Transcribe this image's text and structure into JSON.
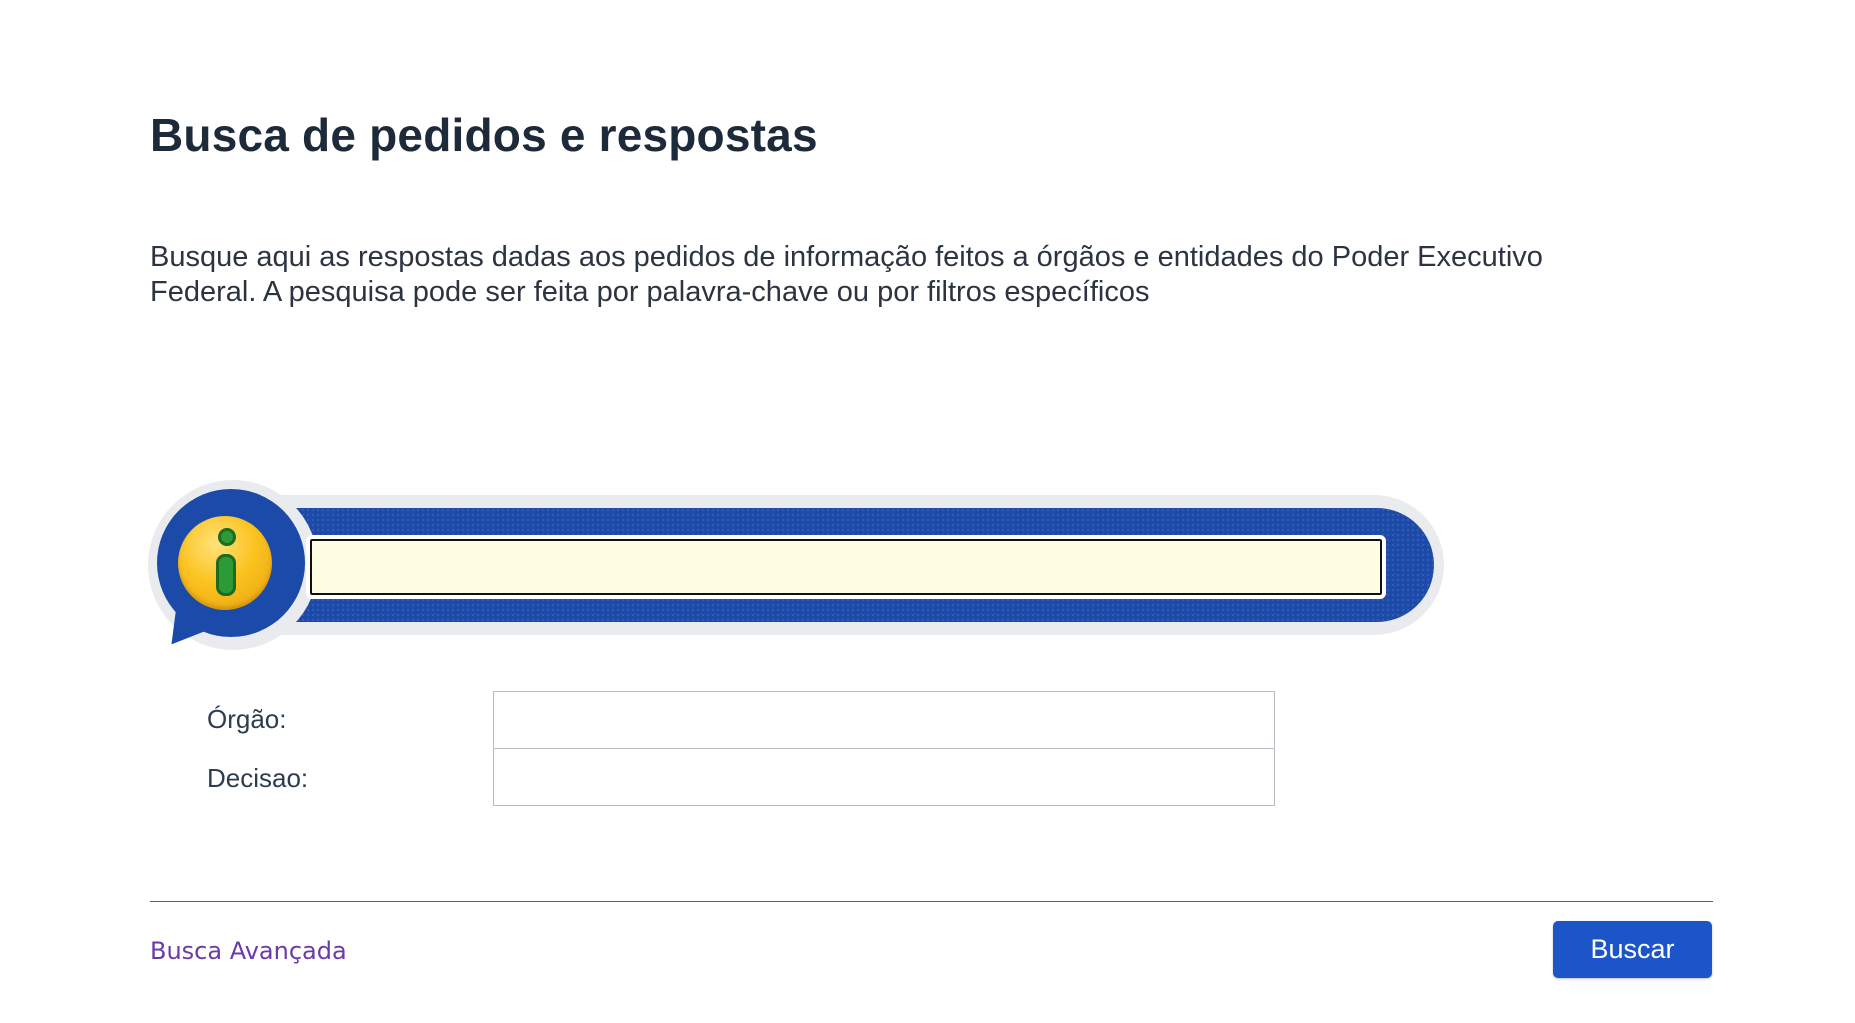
{
  "page": {
    "title": "Busca de pedidos e respostas",
    "description": "Busque aqui as respostas dadas aos pedidos de informação feitos a órgãos e entidades do Poder Executivo Federal. A pesquisa pode ser feita por palavra-chave ou por filtros específicos"
  },
  "search": {
    "value": "",
    "placeholder": "",
    "icon": "info-icon"
  },
  "filters": {
    "orgao_label": "Órgão:",
    "orgao_value": "",
    "decisao_label": "Decisao:",
    "decisao_value": ""
  },
  "footer": {
    "advanced_link": "Busca Avançada",
    "search_button": "Buscar"
  },
  "colors": {
    "primary": "#1c55c7",
    "banner_blue": "#1c4aa8",
    "input_bg": "#fffde2",
    "link": "#6b3aa8",
    "title": "#1c2a3a"
  }
}
